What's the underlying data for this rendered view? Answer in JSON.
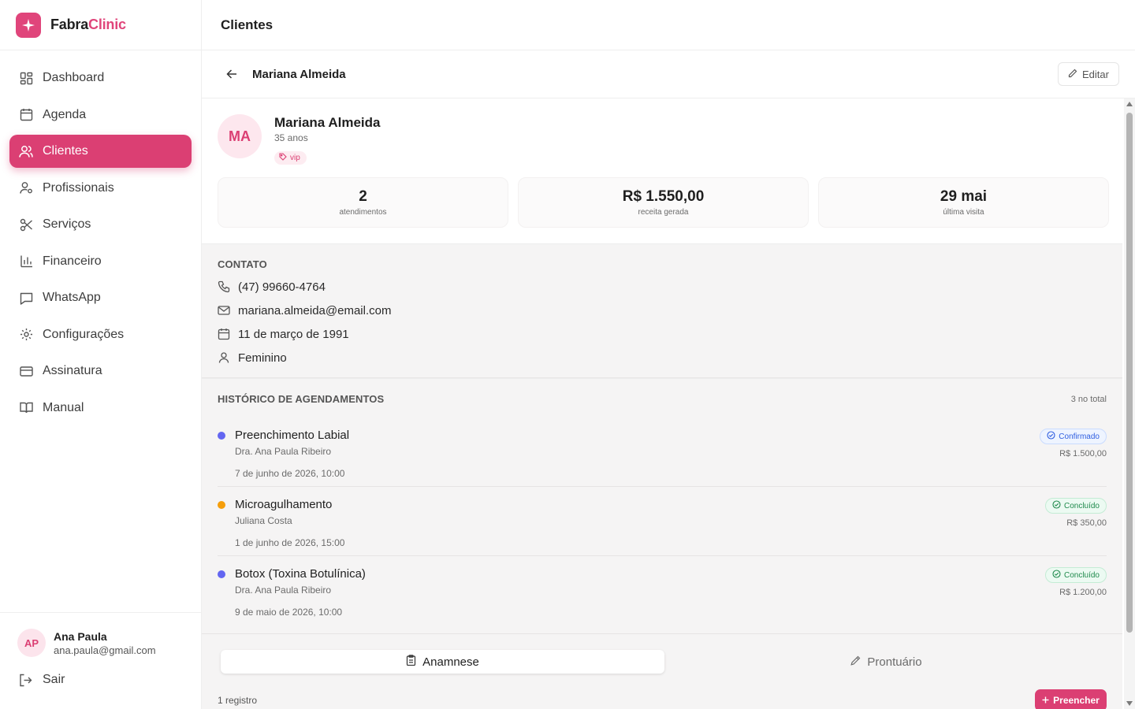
{
  "brand": {
    "name_primary": "Fabra",
    "name_accent": "Clinic",
    "accent_color": "#db3f73"
  },
  "sidebar": {
    "items": [
      {
        "label": "Dashboard",
        "icon": "dashboard-icon"
      },
      {
        "label": "Agenda",
        "icon": "calendar-icon"
      },
      {
        "label": "Clientes",
        "icon": "users-icon",
        "active": true
      },
      {
        "label": "Profissionais",
        "icon": "user-cog-icon"
      },
      {
        "label": "Serviços",
        "icon": "scissors-icon"
      },
      {
        "label": "Financeiro",
        "icon": "bar-chart-icon"
      },
      {
        "label": "WhatsApp",
        "icon": "chat-icon"
      },
      {
        "label": "Configurações",
        "icon": "gear-icon"
      },
      {
        "label": "Assinatura",
        "icon": "credit-card-icon"
      },
      {
        "label": "Manual",
        "icon": "book-icon"
      }
    ],
    "user": {
      "initials": "AP",
      "name": "Ana Paula",
      "email": "ana.paula@gmail.com"
    },
    "logout_label": "Sair"
  },
  "header": {
    "title": "Clientes"
  },
  "subheader": {
    "title": "Mariana Almeida",
    "edit_label": "Editar"
  },
  "client": {
    "initials": "MA",
    "name": "Mariana Almeida",
    "age": "35 anos",
    "tag": "vip",
    "stats": [
      {
        "value": "2",
        "label": "atendimentos"
      },
      {
        "value": "R$ 1.550,00",
        "label": "receita gerada"
      },
      {
        "value": "29 mai",
        "label": "última visita"
      }
    ]
  },
  "contact": {
    "title": "CONTATO",
    "phone": "(47) 99660-4764",
    "email": "mariana.almeida@email.com",
    "birthdate": "11 de março de 1991",
    "gender": "Feminino"
  },
  "history": {
    "title": "HISTÓRICO DE AGENDAMENTOS",
    "count": "3 no total",
    "items": [
      {
        "service": "Preenchimento Labial",
        "professional": "Dra. Ana Paula Ribeiro",
        "date": "7 de junho de 2026, 10:00",
        "status": "Confirmado",
        "price": "R$ 1.500,00",
        "dot_color": "#6366f1"
      },
      {
        "service": "Microagulhamento",
        "professional": "Juliana Costa",
        "date": "1 de junho de 2026, 15:00",
        "status": "Concluído",
        "price": "R$ 350,00",
        "dot_color": "#f59e0b"
      },
      {
        "service": "Botox (Toxina Botulínica)",
        "professional": "Dra. Ana Paula Ribeiro",
        "date": "9 de maio de 2026, 10:00",
        "status": "Concluído",
        "price": "R$ 1.200,00",
        "dot_color": "#6366f1"
      }
    ]
  },
  "tabs": {
    "anamnese": "Anamnese",
    "prontuario": "Prontuário"
  },
  "records": {
    "count": "1 registro",
    "fill_label": "Preencher"
  }
}
